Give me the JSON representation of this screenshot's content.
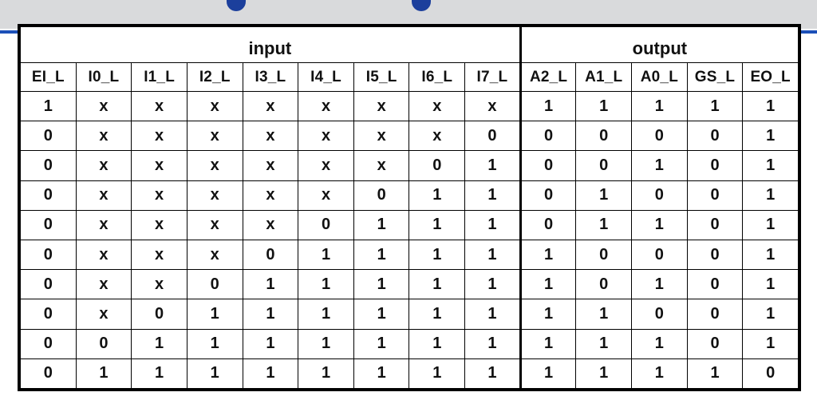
{
  "table": {
    "groups": [
      {
        "label": "input",
        "span": 9
      },
      {
        "label": "output",
        "span": 5
      }
    ],
    "columns": [
      "EI_L",
      "I0_L",
      "I1_L",
      "I2_L",
      "I3_L",
      "I4_L",
      "I5_L",
      "I6_L",
      "I7_L",
      "A2_L",
      "A1_L",
      "A0_L",
      "GS_L",
      "EO_L"
    ],
    "input_count": 9,
    "rows": [
      [
        "1",
        "x",
        "x",
        "x",
        "x",
        "x",
        "x",
        "x",
        "x",
        "1",
        "1",
        "1",
        "1",
        "1"
      ],
      [
        "0",
        "x",
        "x",
        "x",
        "x",
        "x",
        "x",
        "x",
        "0",
        "0",
        "0",
        "0",
        "0",
        "1"
      ],
      [
        "0",
        "x",
        "x",
        "x",
        "x",
        "x",
        "x",
        "0",
        "1",
        "0",
        "0",
        "1",
        "0",
        "1"
      ],
      [
        "0",
        "x",
        "x",
        "x",
        "x",
        "x",
        "0",
        "1",
        "1",
        "0",
        "1",
        "0",
        "0",
        "1"
      ],
      [
        "0",
        "x",
        "x",
        "x",
        "x",
        "0",
        "1",
        "1",
        "1",
        "0",
        "1",
        "1",
        "0",
        "1"
      ],
      [
        "0",
        "x",
        "x",
        "x",
        "0",
        "1",
        "1",
        "1",
        "1",
        "1",
        "0",
        "0",
        "0",
        "1"
      ],
      [
        "0",
        "x",
        "x",
        "0",
        "1",
        "1",
        "1",
        "1",
        "1",
        "1",
        "0",
        "1",
        "0",
        "1"
      ],
      [
        "0",
        "x",
        "0",
        "1",
        "1",
        "1",
        "1",
        "1",
        "1",
        "1",
        "1",
        "0",
        "0",
        "1"
      ],
      [
        "0",
        "0",
        "1",
        "1",
        "1",
        "1",
        "1",
        "1",
        "1",
        "1",
        "1",
        "1",
        "0",
        "1"
      ],
      [
        "0",
        "1",
        "1",
        "1",
        "1",
        "1",
        "1",
        "1",
        "1",
        "1",
        "1",
        "1",
        "1",
        "0"
      ]
    ],
    "highlight": [
      [],
      [
        8
      ],
      [
        7
      ],
      [
        6
      ],
      [
        5
      ],
      [
        4
      ],
      [
        3
      ],
      [
        2
      ],
      [
        1
      ],
      []
    ]
  },
  "colors": {
    "dont_care": "#1f9f3a",
    "active_low_zero": "#e01010",
    "text": "#111111",
    "accent_line": "#1c50b8",
    "top_band": "#d9dadc"
  }
}
